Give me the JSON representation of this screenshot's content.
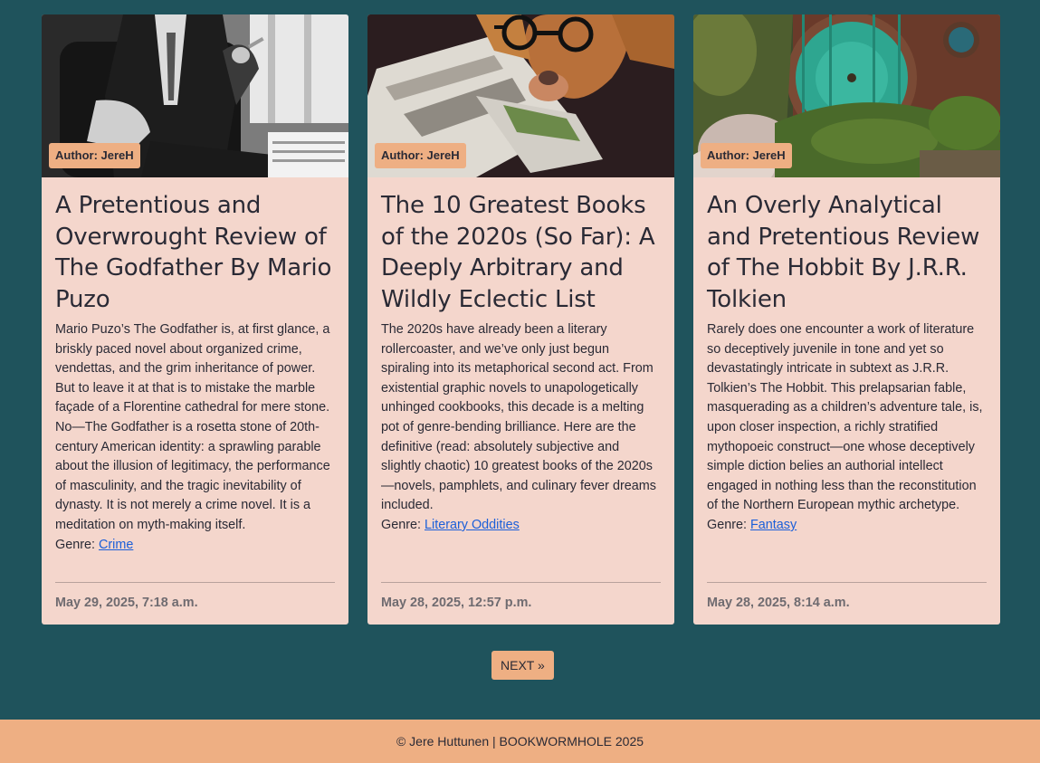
{
  "cards": [
    {
      "author_badge": "Author: JereH",
      "title": "A Pretentious and Overwrought Review of The Godfather By Mario Puzo",
      "excerpt": "Mario Puzo’s The Godfather is, at first glance, a briskly paced novel about organized crime, vendettas, and the grim inheritance of power. But to leave it at that is to mistake the marble façade of a Florentine cathedral for mere stone. No—The Godfather is a rosetta stone of 20th-century American identity: a sprawling parable about the illusion of legitimacy, the performance of masculinity, and the tragic inevitability of dynasty. It is not merely a crime novel. It is a meditation on myth-making itself.",
      "genre_label": "Genre:",
      "genre": "Crime",
      "date": "May 29, 2025, 7:18 a.m."
    },
    {
      "author_badge": "Author: JereH",
      "title": "The 10 Greatest Books of the 2020s (So Far): A Deeply Arbitrary and Wildly Eclectic List",
      "excerpt": "The 2020s have already been a literary rollercoaster, and we’ve only just begun spiraling into its metaphorical second act. From existential graphic novels to unapologetically unhinged cookbooks, this decade is a melting pot of genre-bending brilliance. Here are the definitive (read: absolutely subjective and slightly chaotic) 10 greatest books of the 2020s—novels, pamphlets, and culinary fever dreams included.",
      "genre_label": "Genre:",
      "genre": "Literary Oddities",
      "date": "May 28, 2025, 12:57 p.m."
    },
    {
      "author_badge": "Author: JereH",
      "title": "An Overly Analytical and Pretentious Review of The Hobbit By J.R.R. Tolkien",
      "excerpt": "Rarely does one encounter a work of literature so deceptively juvenile in tone and yet so devastatingly intricate in subtext as J.R.R. Tolkien’s The Hobbit. This prelapsarian fable, masquerading as a children’s adventure tale, is, upon closer inspection, a richly stratified mythopoeic construct—one whose deceptively simple diction belies an authorial intellect engaged in nothing less than the reconstitution of the Northern European mythic archetype.",
      "genre_label": "Genre:",
      "genre": "Fantasy",
      "date": "May 28, 2025, 8:14 a.m."
    }
  ],
  "pagination": {
    "next_label": "NEXT »"
  },
  "footer": {
    "text": "© Jere Huttunen | BOOKWORMHOLE 2025"
  }
}
